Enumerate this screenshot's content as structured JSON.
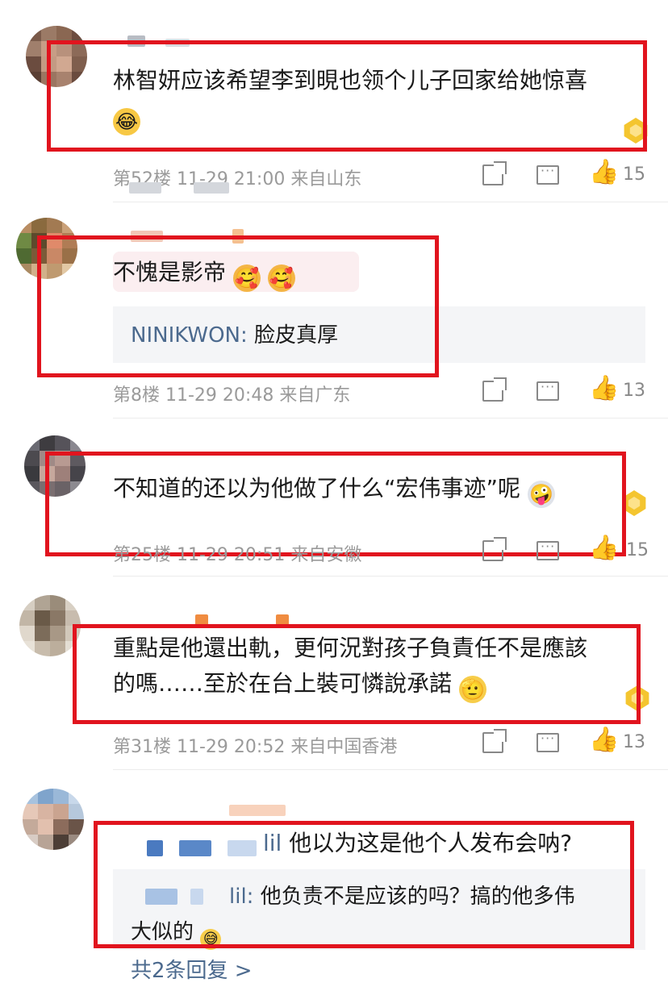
{
  "comments": [
    {
      "text_line1": "林智妍应该希望李到晛也领个儿子回家给她惊喜",
      "emoji": "😂",
      "floor": "第52楼",
      "time": "11-29 21:00",
      "location": "来自山东",
      "likes": "15"
    },
    {
      "text_line1": "不愧是影帝",
      "emoji": "🥰",
      "reply_user": "NINIKWON:",
      "reply_text": "脸皮真厚",
      "floor": "第8楼",
      "time": "11-29 20:48",
      "location": "来自广东",
      "likes": "13"
    },
    {
      "text_line1": "不知道的还以为他做了什么“宏伟事迹”呢",
      "emoji": "🤪",
      "floor": "第25楼",
      "time": "11-29 20:51",
      "location": "来自安徽",
      "likes": "15"
    },
    {
      "text_line1": "重點是他還出軌，更何況對孩子負責任不是應該",
      "text_line2": "的嗎……至於在台上裝可憐說承諾",
      "emoji": "🫡",
      "floor": "第31楼",
      "time": "11-29 20:52",
      "location": "来自中国香港",
      "likes": "13"
    },
    {
      "user_tail": "lil",
      "text_line1": "他以为这是他个人发布会呐?",
      "reply_user": "lil:",
      "reply_text": "他负责不是应该的吗？搞的他多伟",
      "reply_text2": "大似的",
      "more_replies": "共2条回复 >"
    }
  ],
  "colors": {
    "highlight_box": "#e1141e",
    "link_blue": "#4c6a8e",
    "meta_gray": "#9a9a9a"
  }
}
